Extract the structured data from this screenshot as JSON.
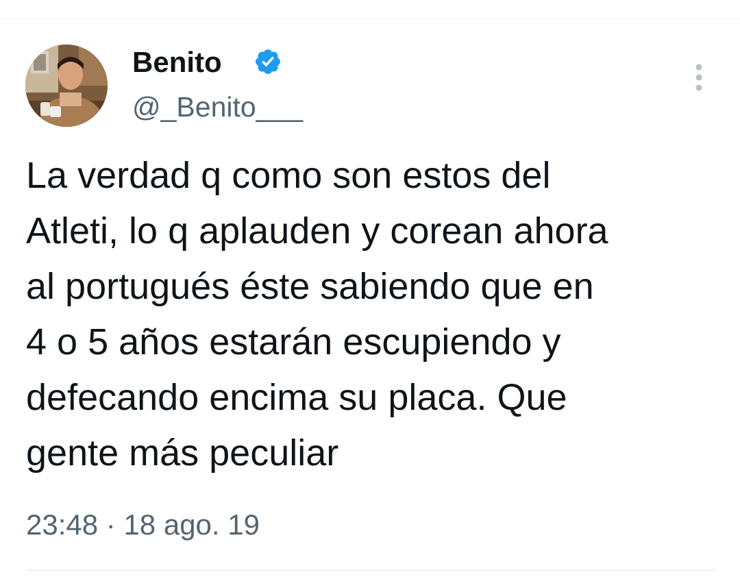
{
  "tweet": {
    "author": {
      "display_name": "Benito",
      "handle": "@_Benito___",
      "verified": true,
      "avatar_icon": "profile-photo"
    },
    "text": "La verdad q como son estos del\nAtleti, lo q aplauden y corean ahora\nal portugués éste sabiendo que en\n4 o 5 años estarán escupiendo y\ndefecando encima su placa. Que\ngente más peculiar",
    "time": "23:48",
    "separator": "·",
    "date": "18 ago. 19"
  },
  "icons": {
    "verified": "verified-badge-icon",
    "more": "more-options-icon"
  },
  "colors": {
    "text": "#0f1419",
    "secondary": "#536471",
    "verified": "#1d9bf0"
  }
}
